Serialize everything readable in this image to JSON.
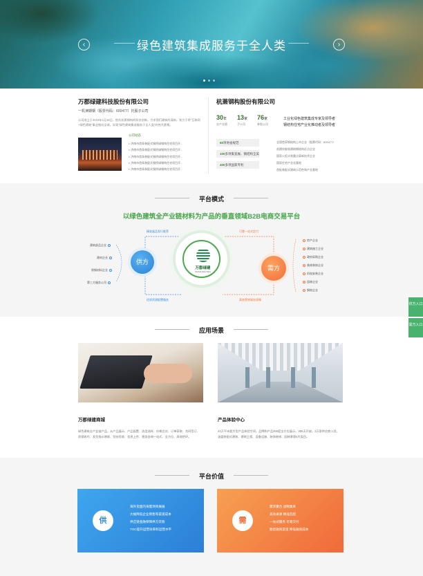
{
  "banner": {
    "title": "绿色建筑集成服务于全人类",
    "prev_icon": "chevron-left-icon",
    "next_icon": "chevron-right-icon",
    "prev_glyph": "‹",
    "next_glyph": "›"
  },
  "company1": {
    "title": "万郡绿建科技股份有限公司",
    "subtitle": "一机津期钢（股票代码：600477）托股子公司",
    "desc": "公司成立于2016年1月18日，依托杭萧钢构的科技创新，力求我们建筑的清新，致力于将“互联网+绿色建筑”事业推向全球，实现“绿色建筑集成服务于全人类”的伟大愿景。",
    "news_heading": "公司动态",
    "news": [
      "济南市首条装配式钢桥绿钢构住宅项目开...",
      "济南市首条装配式钢桥绿钢构住宅项目开...",
      "济南市首条装配式钢桥绿钢构住宅项目开...",
      "济南市首条装配式钢桥绿钢构住宅项目开...",
      "济南市首条装配式钢桥绿钢构住宅项目开..."
    ]
  },
  "company2": {
    "title": "杭萧钢构股份有限公司",
    "stats": [
      {
        "num": "30",
        "unit": "年",
        "label": "业产业绩"
      },
      {
        "num": "13",
        "unit": "家",
        "label": "子公司"
      },
      {
        "num": "76",
        "unit": "家",
        "label": "参股公司"
      }
    ],
    "tagline": [
      "工业化绿色建筑集成专家及领导者",
      "钢结构住宅产业化推动者及领导者"
    ],
    "badges": [
      {
        "num": "60",
        "text": "项地省规范"
      },
      {
        "num": "100",
        "text": "多项集宽展、钢结构全美"
      },
      {
        "num": "400",
        "text": "多项国家专利"
      }
    ],
    "facts": [
      "全国首家钢结构上市企业（股票代码：600477）",
      "创建技能效建筑钢结构近点企业",
      "国家火炬计划重点高新技术企业",
      "国家住宅产业化基地",
      "首批装配式建筑示范性和产业基地"
    ]
  },
  "platform_mode": {
    "title": "平台模式",
    "slogan": "以绿色建筑全产业链材料为产品的垂直领域B2B电商交易平台",
    "supply_label": "供方",
    "demand_label": "需方",
    "logo_text": "万郡绿建",
    "logo_en": "WANJUNLVJIAN",
    "flow_top_left": "精准展品发行推荐",
    "flow_bottom_left": "优质资源配置服务",
    "flow_top_right": "可靠一站式定付",
    "flow_bottom_right": "高效营销服务保障",
    "supply_nodes": [
      "建筑部品企业",
      "建材企业",
      "原钢材料企业",
      "第三方服务公司"
    ],
    "demand_nodes": [
      "房产企业",
      "建筑施工企业",
      "政府采购企业",
      "装修装饰企业",
      "机电安装企业",
      "园林企业",
      "钢结企业"
    ]
  },
  "side_tabs": [
    {
      "text": "供方入口"
    },
    {
      "text": "需方入口"
    }
  ],
  "scenes": {
    "title": "应用场景",
    "items": [
      {
        "title": "万郡绿建商城",
        "desc": "绿色建筑全产业链产品，从产品展示、产品配置、选型选样、价格比对、订单获取、合同签订、质保收付、发货指示增收、别技验收、信息上传、税务咨询一站式、全方位、高效把环。"
      },
      {
        "title": "产品体验中心",
        "desc": "22万平米超大型产品体验空间，品牌和产品365度全方位展示，365天开放。2万家供应商入驻，涵盖装配式建筑、建筑工程、设备设施、装饰装修、园林景观5大类目。"
      }
    ]
  },
  "value": {
    "title": "平台价值",
    "supply_icon": "供",
    "demand_icon": "需",
    "supply_points": [
      "海外及国内海量项目展展",
      "大幅降低企业销售和渠道成本",
      "供应链金融保障供方贷款",
      "TOC提升运营效率和运营水平"
    ],
    "demand_points": [
      "需求聚合  战略集采",
      "高效录源  精准匹配",
      "一站式服务  可靠交付",
      "数智融资渠道  降低融资成本"
    ]
  },
  "colors": {
    "accent_green": "#46a64a",
    "supply_blue": "#2f86dc",
    "demand_orange": "#f06a3a"
  }
}
